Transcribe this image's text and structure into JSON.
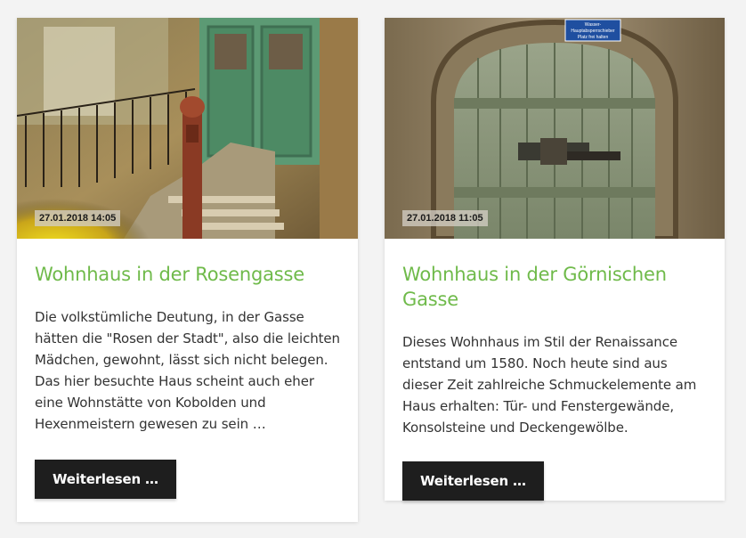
{
  "posts": [
    {
      "date": "27.01.2018 14:05",
      "title": "Wohnhaus in der Rosengasse",
      "excerpt": "Die volkstümliche Deutung, in der Gasse hätten die \"Rosen der Stadt\", also die leichten Mädchen, gewohnt, lässt sich nicht belegen. Das hier besuchte Haus scheint auch eher eine Wohnstätte von Kobolden und Hexenmeistern gewesen zu sein …",
      "read_more_label": "Weiterlesen …"
    },
    {
      "date": "27.01.2018 11:05",
      "title": "Wohnhaus in der Görnischen Gasse",
      "excerpt": "Dieses Wohnhaus im Stil der Renaissance entstand um 1580. Noch heute sind aus dieser Zeit zahlreiche Schmuckelemente am Haus erhalten: Tür- und Fenstergewände, Konsolsteine und Deckengewölbe.",
      "read_more_label": "Weiterlesen …",
      "door_sign_line1": "Wasser-",
      "door_sign_line2": "Hauptabsperrschieber",
      "door_sign_line3": "Platz frei halten"
    }
  ],
  "colors": {
    "title_green": "#6fba4a",
    "button_bg": "#1e1e1e",
    "text": "#333333",
    "page_bg": "#f3f3f3"
  }
}
